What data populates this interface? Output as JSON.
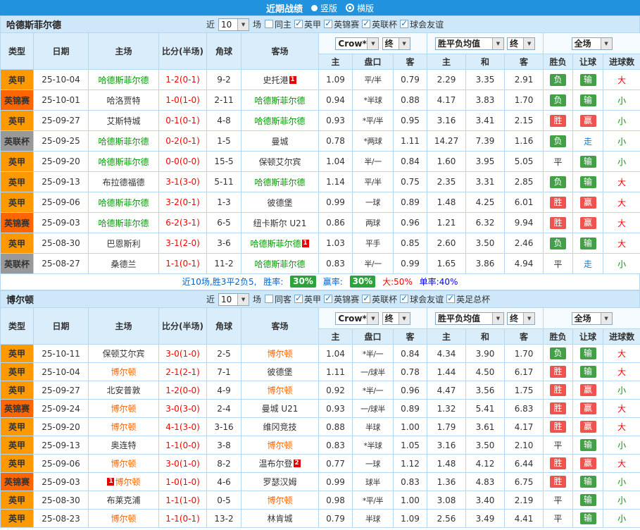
{
  "icons": {
    "caret": "▼"
  },
  "colors": {
    "topbar_bg": "#2192dd",
    "section_bg": "#cfe8f9",
    "head_bg": "#d9edfb",
    "border": "#b7d7ee",
    "leagues": {
      "英甲": "#ff9900",
      "英锦赛": "#ff6600",
      "英联杯": "#999999"
    },
    "win_bg": "#ef5350",
    "loss_bg": "#43a047",
    "walk_text": "#1e7ad2",
    "big_text": "#ff0000",
    "small_text": "#009900",
    "score_text": "#ff0000",
    "pct_bg": "#2da33d"
  },
  "topbar": {
    "title": "近期战绩",
    "radios": [
      {
        "label": "竖版",
        "checked": false
      },
      {
        "label": "横版",
        "checked": true
      }
    ]
  },
  "sections": [
    {
      "team": "哈德斯菲尔德",
      "team_color": "#009900",
      "near_label": "近",
      "count": "10",
      "games_label": "场",
      "checkboxes": [
        {
          "label": "同主",
          "checked": false
        },
        {
          "label": "英甲",
          "checked": true
        },
        {
          "label": "英锦赛",
          "checked": true
        },
        {
          "label": "英联杯",
          "checked": true
        },
        {
          "label": "球会友谊",
          "checked": true
        }
      ],
      "selects": {
        "company": "Crow*",
        "company_time": "终",
        "avg": "胜平负均值",
        "avg_time": "终",
        "scope": "全场"
      },
      "headers": {
        "type": "类型",
        "date": "日期",
        "home": "主场",
        "score": "比分(半场)",
        "corner": "角球",
        "away": "客场",
        "odds_home": "主",
        "handicap": "盘口",
        "odds_away": "客",
        "avg_home": "主",
        "avg_draw": "和",
        "avg_away": "客",
        "result": "胜负",
        "cover": "让球",
        "goals": "进球数"
      },
      "rows": [
        {
          "league": "英甲",
          "date": "25-10-04",
          "home": "哈德斯菲尔德",
          "home_focal": true,
          "score": "1-2(0-1)",
          "corner": "9-2",
          "away": "史托港",
          "away_rc": "1",
          "o_h": "1.09",
          "o_hc": "平/半",
          "o_a": "0.79",
          "a_h": "2.29",
          "a_d": "3.35",
          "a_a": "2.91",
          "res": "负",
          "cov": "输",
          "big": "大"
        },
        {
          "league": "英锦赛",
          "date": "25-10-01",
          "home": "哈洛贾特",
          "score": "1-0(1-0)",
          "corner": "2-11",
          "away": "哈德斯菲尔德",
          "away_focal": true,
          "o_h": "0.94",
          "o_hc": "*半球",
          "o_a": "0.88",
          "a_h": "4.17",
          "a_d": "3.83",
          "a_a": "1.70",
          "res": "负",
          "cov": "输",
          "big": "小"
        },
        {
          "league": "英甲",
          "date": "25-09-27",
          "home": "艾斯特城",
          "score": "0-1(0-1)",
          "corner": "4-8",
          "away": "哈德斯菲尔德",
          "away_focal": true,
          "o_h": "0.93",
          "o_hc": "*平/半",
          "o_a": "0.95",
          "a_h": "3.16",
          "a_d": "3.41",
          "a_a": "2.15",
          "res": "胜",
          "cov": "赢",
          "big": "小"
        },
        {
          "league": "英联杯",
          "date": "25-09-25",
          "home": "哈德斯菲尔德",
          "home_focal": true,
          "score": "0-2(0-1)",
          "corner": "1-5",
          "away": "曼城",
          "o_h": "0.78",
          "o_hc": "*两球",
          "o_a": "1.11",
          "a_h": "14.27",
          "a_d": "7.39",
          "a_a": "1.16",
          "res": "负",
          "cov": "走",
          "big": "小"
        },
        {
          "league": "英甲",
          "date": "25-09-20",
          "home": "哈德斯菲尔德",
          "home_focal": true,
          "score": "0-0(0-0)",
          "corner": "15-5",
          "away": "保顿艾尔宾",
          "o_h": "1.04",
          "o_hc": "半/一",
          "o_a": "0.84",
          "a_h": "1.60",
          "a_d": "3.95",
          "a_a": "5.05",
          "res": "平",
          "cov": "输",
          "big": "小"
        },
        {
          "league": "英甲",
          "date": "25-09-13",
          "home": "布拉德福德",
          "score": "3-1(3-0)",
          "corner": "5-11",
          "away": "哈德斯菲尔德",
          "away_focal": true,
          "o_h": "1.14",
          "o_hc": "平/半",
          "o_a": "0.75",
          "a_h": "2.35",
          "a_d": "3.31",
          "a_a": "2.85",
          "res": "负",
          "cov": "输",
          "big": "大"
        },
        {
          "league": "英甲",
          "date": "25-09-06",
          "home": "哈德斯菲尔德",
          "home_focal": true,
          "score": "3-2(0-1)",
          "corner": "1-3",
          "away": "彼德堡",
          "o_h": "0.99",
          "o_hc": "一球",
          "o_a": "0.89",
          "a_h": "1.48",
          "a_d": "4.25",
          "a_a": "6.01",
          "res": "胜",
          "cov": "赢",
          "big": "大"
        },
        {
          "league": "英锦赛",
          "date": "25-09-03",
          "home": "哈德斯菲尔德",
          "home_focal": true,
          "score": "6-2(3-1)",
          "corner": "6-5",
          "away": "纽卡斯尔 U21",
          "o_h": "0.86",
          "o_hc": "两球",
          "o_a": "0.96",
          "a_h": "1.21",
          "a_d": "6.32",
          "a_a": "9.94",
          "res": "胜",
          "cov": "赢",
          "big": "大"
        },
        {
          "league": "英甲",
          "date": "25-08-30",
          "home": "巴恩斯利",
          "score": "3-1(2-0)",
          "corner": "3-6",
          "away": "哈德斯菲尔德",
          "away_focal": true,
          "away_rc": "1",
          "o_h": "1.03",
          "o_hc": "平手",
          "o_a": "0.85",
          "a_h": "2.60",
          "a_d": "3.50",
          "a_a": "2.46",
          "res": "负",
          "cov": "输",
          "big": "大"
        },
        {
          "league": "英联杯",
          "date": "25-08-27",
          "home": "桑德兰",
          "score": "1-1(0-1)",
          "corner": "11-2",
          "away": "哈德斯菲尔德",
          "away_focal": true,
          "o_h": "0.83",
          "o_hc": "半/一",
          "o_a": "0.99",
          "a_h": "1.65",
          "a_d": "3.86",
          "a_a": "4.94",
          "res": "平",
          "cov": "走",
          "big": "小"
        }
      ],
      "summary": {
        "prefix": "近10场,胜3平2负5,",
        "win_rate_label": "胜率:",
        "win_rate": "30%",
        "cover_rate_label": "赢率:",
        "cover_rate": "30%",
        "big_label": "大:50%",
        "single_label": "单率:40%"
      }
    },
    {
      "team": "博尔顿",
      "team_color": "#ff6600",
      "near_label": "近",
      "count": "10",
      "games_label": "场",
      "checkboxes": [
        {
          "label": "同客",
          "checked": false
        },
        {
          "label": "英甲",
          "checked": true
        },
        {
          "label": "英锦赛",
          "checked": true
        },
        {
          "label": "英联杯",
          "checked": true
        },
        {
          "label": "球会友谊",
          "checked": true
        },
        {
          "label": "英足总杯",
          "checked": true
        }
      ],
      "selects": {
        "company": "Crow*",
        "company_time": "终",
        "avg": "胜平负均值",
        "avg_time": "终",
        "scope": "全场"
      },
      "headers": {
        "type": "类型",
        "date": "日期",
        "home": "主场",
        "score": "比分(半场)",
        "corner": "角球",
        "away": "客场",
        "odds_home": "主",
        "handicap": "盘口",
        "odds_away": "客",
        "avg_home": "主",
        "avg_draw": "和",
        "avg_away": "客",
        "result": "胜负",
        "cover": "让球",
        "goals": "进球数"
      },
      "rows": [
        {
          "league": "英甲",
          "date": "25-10-11",
          "home": "保顿艾尔宾",
          "score": "3-0(1-0)",
          "corner": "2-5",
          "away": "博尔顿",
          "away_focal": true,
          "o_h": "1.04",
          "o_hc": "*半/一",
          "o_a": "0.84",
          "a_h": "4.34",
          "a_d": "3.90",
          "a_a": "1.70",
          "res": "负",
          "cov": "输",
          "big": "大"
        },
        {
          "league": "英甲",
          "date": "25-10-04",
          "home": "博尔顿",
          "home_focal": true,
          "score": "2-1(2-1)",
          "corner": "7-1",
          "away": "彼德堡",
          "o_h": "1.11",
          "o_hc": "一/球半",
          "o_a": "0.78",
          "a_h": "1.44",
          "a_d": "4.50",
          "a_a": "6.17",
          "res": "胜",
          "cov": "输",
          "big": "大"
        },
        {
          "league": "英甲",
          "date": "25-09-27",
          "home": "北安普敦",
          "score": "1-2(0-0)",
          "corner": "4-9",
          "away": "博尔顿",
          "away_focal": true,
          "o_h": "0.92",
          "o_hc": "*半/一",
          "o_a": "0.96",
          "a_h": "4.47",
          "a_d": "3.56",
          "a_a": "1.75",
          "res": "胜",
          "cov": "赢",
          "big": "小"
        },
        {
          "league": "英锦赛",
          "date": "25-09-24",
          "home": "博尔顿",
          "home_focal": true,
          "score": "3-0(3-0)",
          "corner": "2-4",
          "away": "曼城 U21",
          "o_h": "0.93",
          "o_hc": "一/球半",
          "o_a": "0.89",
          "a_h": "1.32",
          "a_d": "5.41",
          "a_a": "6.83",
          "res": "胜",
          "cov": "赢",
          "big": "大"
        },
        {
          "league": "英甲",
          "date": "25-09-20",
          "home": "博尔顿",
          "home_focal": true,
          "score": "4-1(3-0)",
          "corner": "3-16",
          "away": "维冈竞技",
          "o_h": "0.88",
          "o_hc": "半球",
          "o_a": "1.00",
          "a_h": "1.79",
          "a_d": "3.61",
          "a_a": "4.17",
          "res": "胜",
          "cov": "赢",
          "big": "大"
        },
        {
          "league": "英甲",
          "date": "25-09-13",
          "home": "奥连特",
          "score": "1-1(0-0)",
          "corner": "3-8",
          "away": "博尔顿",
          "away_focal": true,
          "o_h": "0.83",
          "o_hc": "*半球",
          "o_a": "1.05",
          "a_h": "3.16",
          "a_d": "3.50",
          "a_a": "2.10",
          "res": "平",
          "cov": "输",
          "big": "小"
        },
        {
          "league": "英甲",
          "date": "25-09-06",
          "home": "博尔顿",
          "home_focal": true,
          "score": "3-0(1-0)",
          "corner": "8-2",
          "away": "温布尔登",
          "away_rc": "2",
          "o_h": "0.77",
          "o_hc": "一球",
          "o_a": "1.12",
          "a_h": "1.48",
          "a_d": "4.12",
          "a_a": "6.44",
          "res": "胜",
          "cov": "赢",
          "big": "大"
        },
        {
          "league": "英锦赛",
          "date": "25-09-03",
          "home": "博尔顿",
          "home_focal": true,
          "home_rc": "1",
          "home_rc_before": true,
          "score": "1-0(1-0)",
          "corner": "4-6",
          "away": "罗瑟汉姆",
          "o_h": "0.99",
          "o_hc": "球半",
          "o_a": "0.83",
          "a_h": "1.36",
          "a_d": "4.83",
          "a_a": "6.75",
          "res": "胜",
          "cov": "输",
          "big": "小"
        },
        {
          "league": "英甲",
          "date": "25-08-30",
          "home": "布莱克浦",
          "score": "1-1(1-0)",
          "corner": "0-5",
          "away": "博尔顿",
          "away_focal": true,
          "o_h": "0.98",
          "o_hc": "*平/半",
          "o_a": "1.00",
          "a_h": "3.08",
          "a_d": "3.40",
          "a_a": "2.19",
          "res": "平",
          "cov": "输",
          "big": "小"
        },
        {
          "league": "英甲",
          "date": "25-08-23",
          "home": "博尔顿",
          "home_focal": true,
          "score": "1-1(0-1)",
          "corner": "13-2",
          "away": "林肯城",
          "o_h": "0.79",
          "o_hc": "半球",
          "o_a": "1.09",
          "a_h": "2.56",
          "a_d": "3.49",
          "a_a": "4.41",
          "res": "平",
          "cov": "输",
          "big": "小"
        }
      ]
    }
  ]
}
